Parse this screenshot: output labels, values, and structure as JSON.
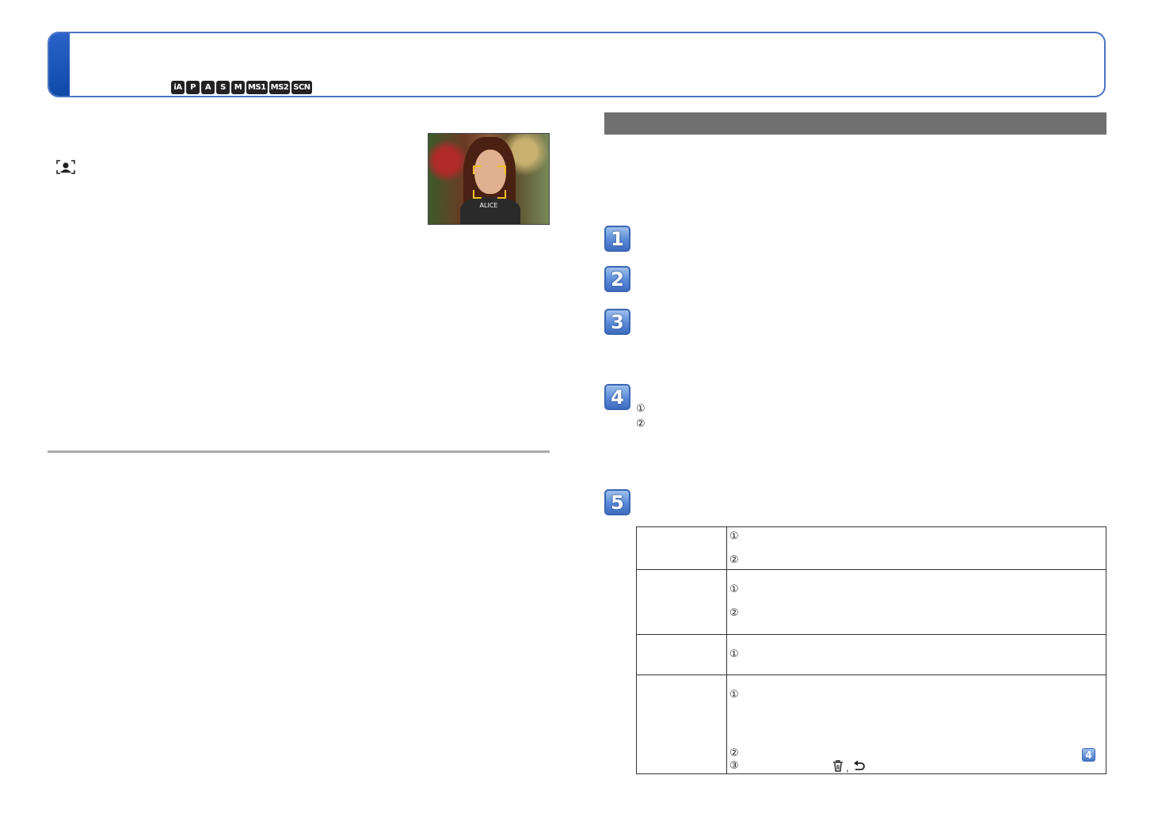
{
  "header": {
    "mode_icons": [
      "iA",
      "P",
      "A",
      "S",
      "M",
      "MS1",
      "MS2",
      "SCN"
    ]
  },
  "photo": {
    "caption": "ALICE"
  },
  "steps": [
    "1",
    "2",
    "3",
    "4",
    "5"
  ],
  "step4_markers": [
    "①",
    "②"
  ],
  "table": {
    "row1_markers": [
      "①",
      "②"
    ],
    "row2_markers": [
      "①",
      "②"
    ],
    "row3_markers": [
      "①"
    ],
    "row4_markers": [
      "①",
      "②",
      "③"
    ],
    "step_ref": "4",
    "separator": ","
  },
  "icons": {
    "face": "face-recognition-icon",
    "trash": "trash-icon",
    "return": "return-icon"
  },
  "colors": {
    "header_border": "#4a74c4",
    "header_tab": "#1f56b8",
    "section_bar": "#707070",
    "step_blue": "#5a8ad6"
  }
}
